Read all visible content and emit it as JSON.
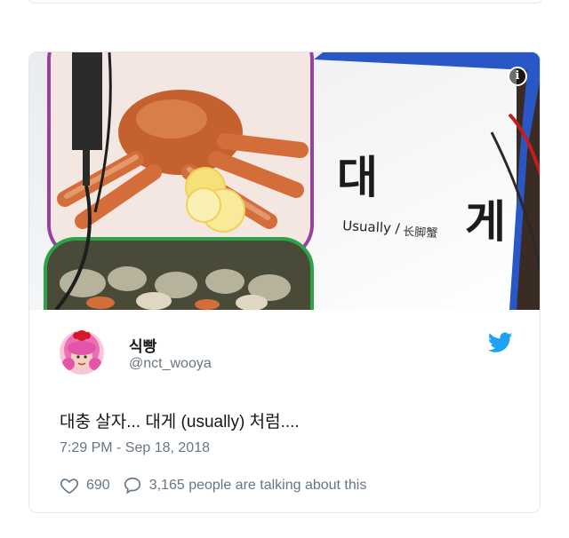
{
  "tweet": {
    "display_name": "식빵",
    "handle": "@nct_wooya",
    "text": "대충 살자... 대게 (usually) 처럼....",
    "timestamp": "7:29 PM - Sep 18, 2018",
    "likes": "690",
    "conversation": "3,165 people are talking about this"
  },
  "media": {
    "sign_hangul_1": "대",
    "sign_hangul_2": "게",
    "sign_english": "Usually /",
    "sign_chinese": "长脚蟹"
  },
  "colors": {
    "twitter_blue": "#1da1f2",
    "text_primary": "#14171a",
    "text_secondary": "#657786",
    "border": "#e1e8ed"
  },
  "icons": [
    "info-icon",
    "twitter-bird-icon",
    "heart-icon",
    "speech-bubble-icon"
  ]
}
